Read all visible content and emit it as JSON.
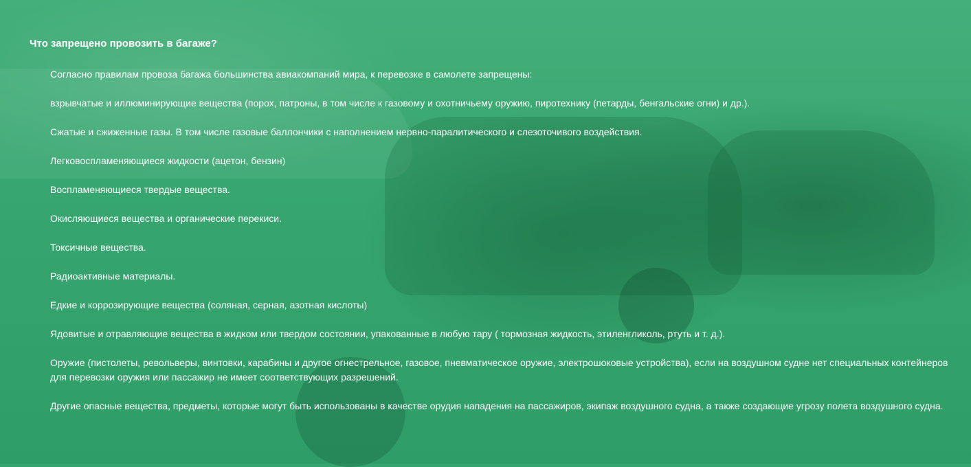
{
  "section": {
    "title": "Что запрещено провозить в багаже?",
    "intro": "Согласно правилам провоза багажа большинства авиакомпаний мира, к перевозке в самолете запрещены:",
    "items": [
      "взрывчатые и иллюминирующие вещества (порох, патроны, в том числе к газовому и охотничьему оружию, пиротехнику (петарды, бенгальские огни) и др.).",
      "Сжатые и сжиженные газы. В том числе газовые баллончики с наполнением нервно-паралитического и слезоточивого воздействия.",
      "Легковоспламеняющиеся жидкости (ацетон, бензин)",
      "Воспламеняющиеся твердые вещества.",
      "Окисляющиеся вещества и органические перекиси.",
      "Токсичные вещества.",
      "Радиоактивные материалы.",
      "Едкие и коррозирующие вещества (соляная, серная, азотная кислоты)",
      "Ядовитые и отравляющие вещества в жидком или твердом состоянии, упакованные в любую тару ( тормозная жидкость, этиленгликоль, ртуть и т. д.).",
      "Оружие (пистолеты, револьверы, винтовки, карабины и другое огнестрельное, газовое, пневматическое оружие, электрошоковые устройства),  если на воздушном судне нет специальных контейнеров для перевозки оружия или пассажир не имеет соответствующих разрешений.",
      "Другие опасные вещества, предметы, которые могут быть использованы в качестве орудия нападения на пассажиров, экипаж воздушного судна, а также создающие угрозу полета воздушного судна."
    ]
  },
  "colors": {
    "overlay": "#36a46f",
    "text": "#ffffff"
  }
}
